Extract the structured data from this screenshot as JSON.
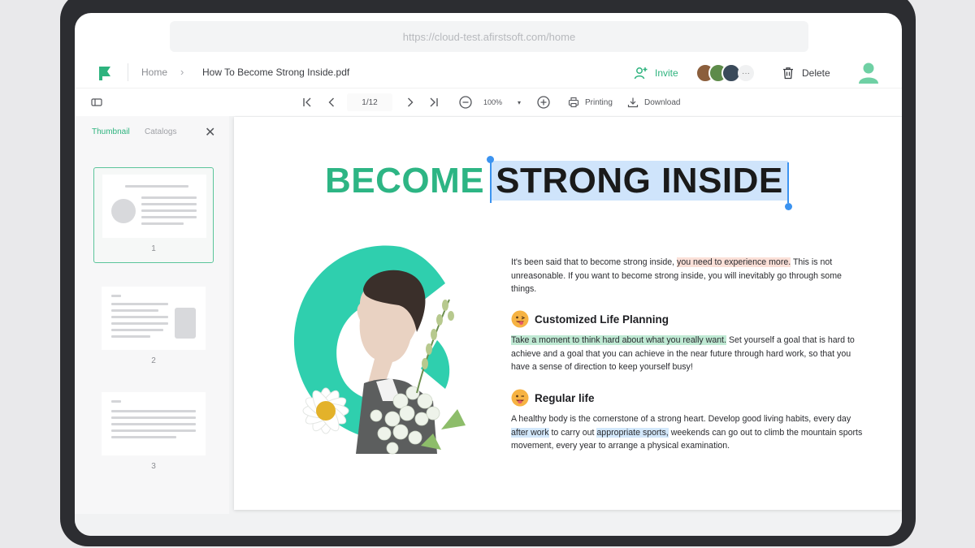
{
  "browser": {
    "url": "https://cloud-test.afirstsoft.com/home"
  },
  "header": {
    "breadcrumb_home": "Home",
    "file_name": "How To Become Strong Inside.pdf",
    "invite_label": "Invite",
    "more_avatars": "···",
    "delete_label": "Delete"
  },
  "toolbar": {
    "page_indicator": "1/12",
    "zoom_level": "100%",
    "print_label": "Printing",
    "download_label": "Download"
  },
  "sidebar": {
    "tabs": [
      {
        "label": "Thumbnail",
        "active": true
      },
      {
        "label": "Catalogs",
        "active": false
      }
    ],
    "thumbnails": [
      {
        "number": "1",
        "selected": true
      },
      {
        "number": "2",
        "selected": false
      },
      {
        "number": "3",
        "selected": false
      }
    ]
  },
  "document": {
    "title_part1": "BECOME",
    "title_part2": "STRONG INSIDE",
    "intro": {
      "pre": "It's been said that to become strong inside, ",
      "highlight": "you need to experience more.",
      "post": " This is not unreasonable. If you want to become strong inside, you will inevitably go through some things."
    },
    "section1": {
      "heading": "Customized Life Planning",
      "highlight": "Take a moment to think hard about what you really want.",
      "post": " Set yourself a goal that is hard to achieve and a goal that you can achieve in the near future through hard work, so that you have a sense of direction to keep yourself busy!"
    },
    "section2": {
      "heading": "Regular life",
      "pre": "A healthy body is the cornerstone of a strong heart. Develop good living habits, every day ",
      "highlight1": "after work",
      "mid": " to carry out ",
      "highlight2": "appropriate sports,",
      "post": " weekends can go out to climb the mountain sports movement, every year to arrange a physical examination."
    }
  },
  "colors": {
    "accent": "#2db37e",
    "title_green": "#2db584",
    "selection": "#cfe4fb",
    "highlight_pink": "#fbe0d8",
    "highlight_green": "#bfe9d3",
    "highlight_blue": "#d3e8fb",
    "device_frame": "#2c2d31"
  },
  "icons": {
    "logo": "flag-logo-icon",
    "invite": "add-user-icon",
    "delete": "trash-icon",
    "user": "user-avatar-icon",
    "sidebar_toggle": "sidebar-toggle-icon",
    "first_page": "first-page-icon",
    "prev_page": "prev-page-icon",
    "next_page": "next-page-icon",
    "last_page": "last-page-icon",
    "zoom_out": "zoom-out-icon",
    "zoom_in": "zoom-in-icon",
    "print": "printer-icon",
    "download": "download-icon",
    "close": "close-icon"
  }
}
